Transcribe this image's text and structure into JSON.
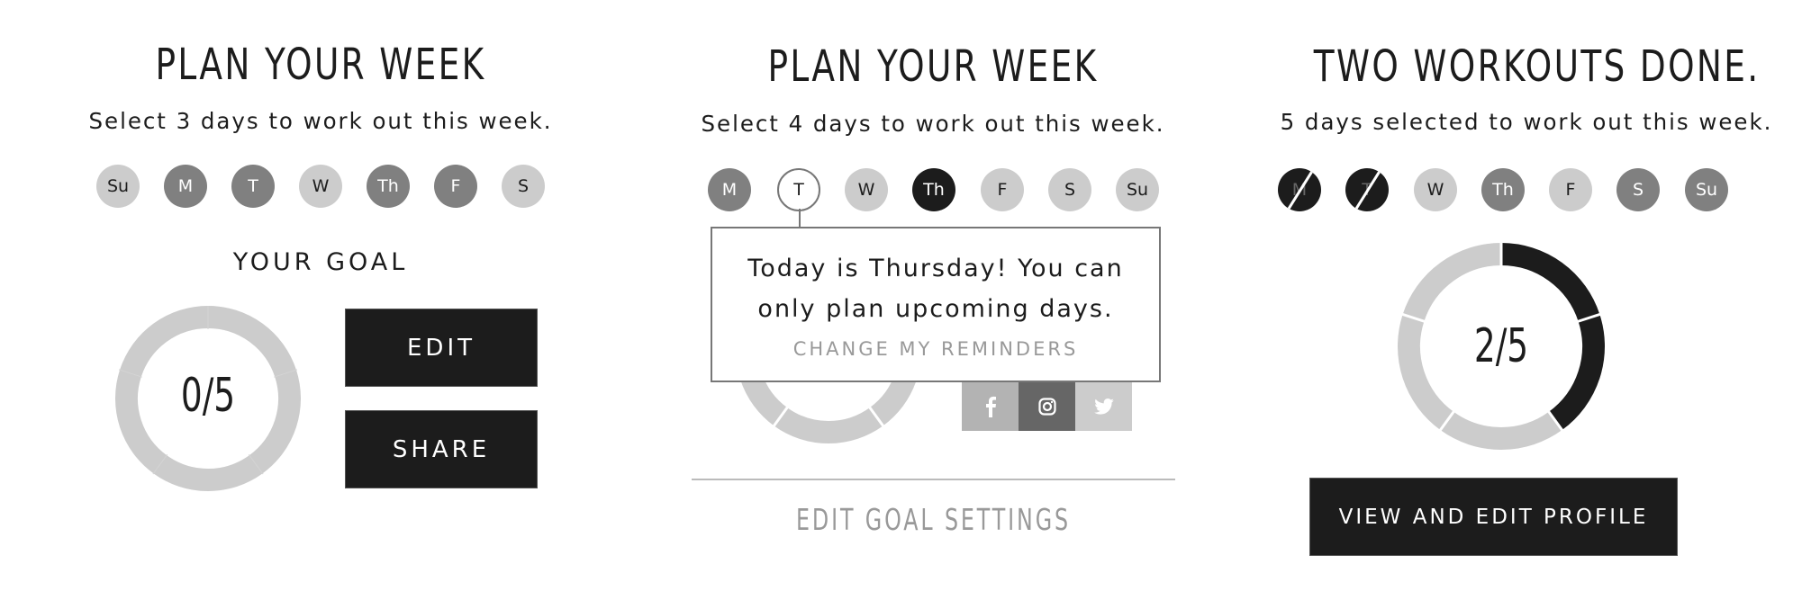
{
  "panels": [
    {
      "title": "PLAN YOUR WEEK",
      "subtitle": "Select 3 days to work out this week.",
      "days": [
        {
          "label": "Su",
          "state": "unselected"
        },
        {
          "label": "M",
          "state": "selected"
        },
        {
          "label": "T",
          "state": "selected"
        },
        {
          "label": "W",
          "state": "unselected"
        },
        {
          "label": "Th",
          "state": "selected"
        },
        {
          "label": "F",
          "state": "selected"
        },
        {
          "label": "S",
          "state": "unselected"
        }
      ],
      "goal_label": "YOUR GOAL",
      "progress": {
        "done": 0,
        "goal": 5,
        "text": "0/5"
      },
      "buttons": {
        "edit": "EDIT",
        "share": "SHARE"
      }
    },
    {
      "title": "PLAN YOUR WEEK",
      "subtitle": "Select 4 days to work out this week.",
      "days": [
        {
          "label": "M",
          "state": "selected"
        },
        {
          "label": "T",
          "state": "focused"
        },
        {
          "label": "W",
          "state": "unselected"
        },
        {
          "label": "Th",
          "state": "today"
        },
        {
          "label": "F",
          "state": "unselected"
        },
        {
          "label": "S",
          "state": "unselected"
        },
        {
          "label": "Su",
          "state": "unselected"
        }
      ],
      "tooltip": {
        "line1": "Today is Thursday! You can",
        "line2": "only plan upcoming days.",
        "link": "CHANGE MY REMINDERS"
      },
      "progress": {
        "done": 0,
        "goal": 5
      },
      "social": [
        {
          "name": "facebook",
          "glyph": "f",
          "color": "#b3b3b3"
        },
        {
          "name": "instagram",
          "glyph": "ig",
          "color": "#666666"
        },
        {
          "name": "twitter",
          "glyph": "tw",
          "color": "#cccccc"
        }
      ],
      "edit_goal_settings": "EDIT GOAL SETTINGS"
    },
    {
      "title": "TWO WORKOUTS DONE.",
      "subtitle": "5 days selected to work out this week.",
      "days": [
        {
          "label": "M",
          "state": "completed"
        },
        {
          "label": "T",
          "state": "completed"
        },
        {
          "label": "W",
          "state": "unselected"
        },
        {
          "label": "Th",
          "state": "selected"
        },
        {
          "label": "F",
          "state": "unselected"
        },
        {
          "label": "S",
          "state": "selected"
        },
        {
          "label": "Su",
          "state": "selected"
        }
      ],
      "progress": {
        "done": 2,
        "goal": 5,
        "text": "2/5"
      },
      "button": "VIEW AND EDIT PROFILE"
    }
  ],
  "colors": {
    "dark": "#1c1c1c",
    "mid": "#808080",
    "light": "#cccccc",
    "muted_text": "#999999"
  }
}
